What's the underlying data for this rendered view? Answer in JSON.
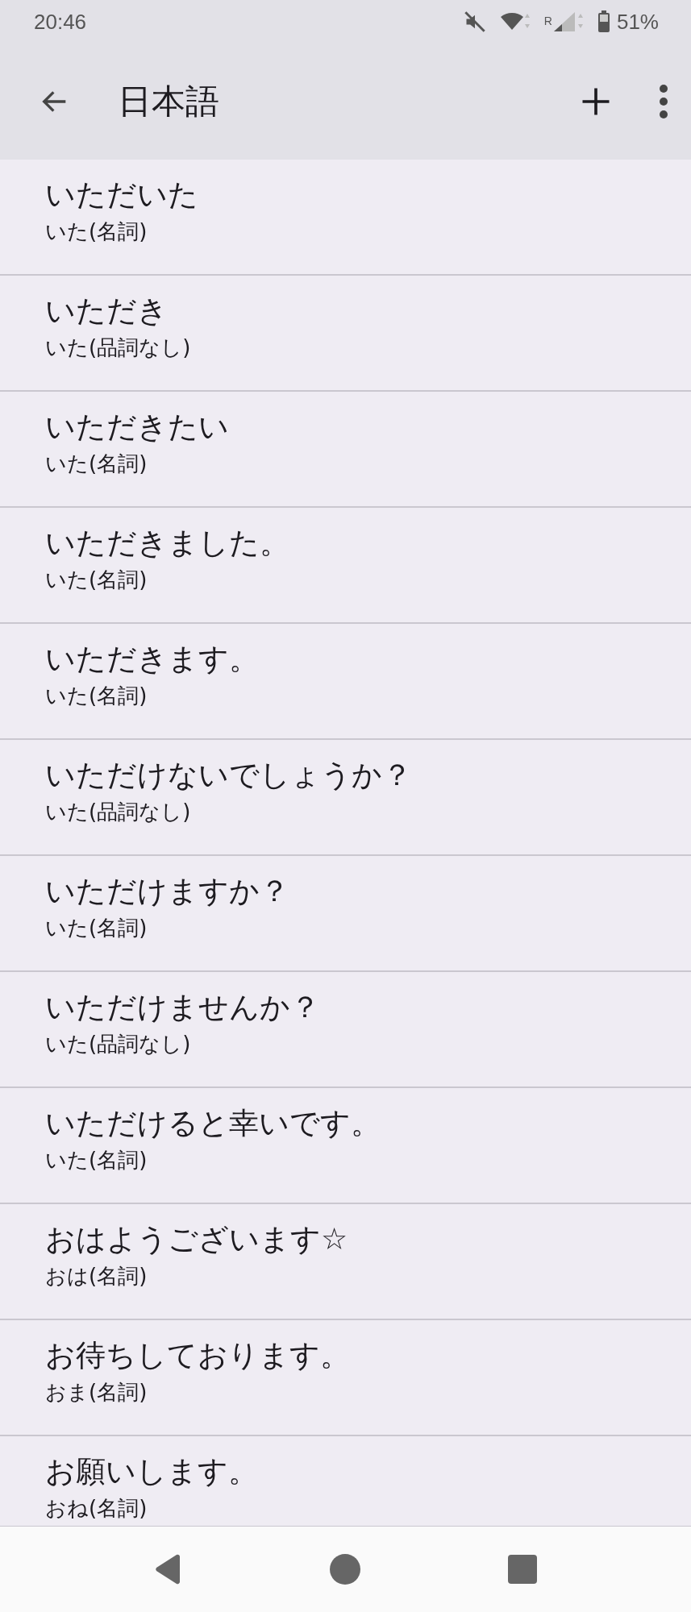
{
  "status_bar": {
    "time": "20:46",
    "roaming": "R",
    "battery": "51%"
  },
  "toolbar": {
    "title": "日本語"
  },
  "items": [
    {
      "word": "いただいた",
      "reading": "いた(名詞)"
    },
    {
      "word": "いただき",
      "reading": "いた(品詞なし)"
    },
    {
      "word": "いただきたい",
      "reading": "いた(名詞)"
    },
    {
      "word": "いただきました。",
      "reading": "いた(名詞)"
    },
    {
      "word": "いただきます。",
      "reading": "いた(名詞)"
    },
    {
      "word": "いただけないでしょうか？",
      "reading": "いた(品詞なし)"
    },
    {
      "word": "いただけますか？",
      "reading": "いた(名詞)"
    },
    {
      "word": "いただけませんか？",
      "reading": "いた(品詞なし)"
    },
    {
      "word": "いただけると幸いです。",
      "reading": "いた(名詞)"
    },
    {
      "word": "おはようございます☆",
      "reading": "おは(名詞)"
    },
    {
      "word": "お待ちしております。",
      "reading": "おま(名詞)"
    },
    {
      "word": "お願いします。",
      "reading": "おね(名詞)"
    }
  ]
}
